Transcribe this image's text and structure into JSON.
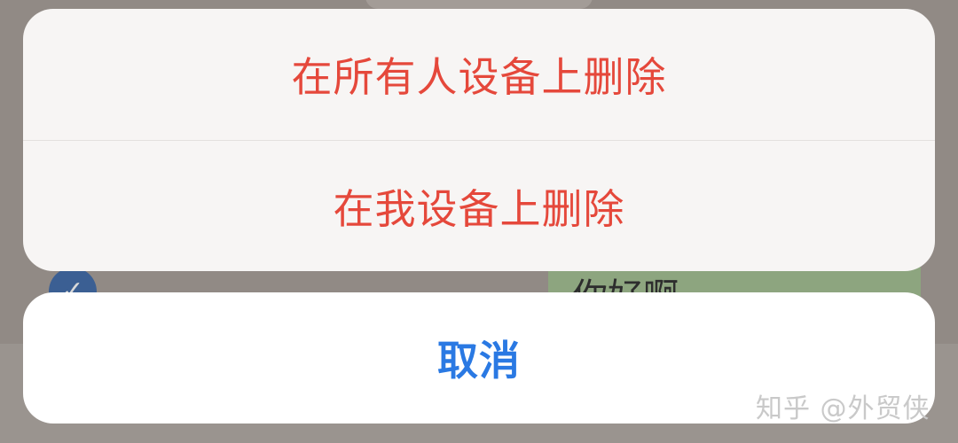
{
  "background": {
    "bubble_text": "你好啊",
    "check_symbol": "✓"
  },
  "action_sheet": {
    "delete_for_everyone_label": "在所有人设备上删除",
    "delete_for_me_label": "在我设备上删除",
    "cancel_label": "取消",
    "destructive_color": "#e5483b",
    "cancel_color": "#2a79e3"
  },
  "watermark": {
    "text": "知乎 @外贸侠"
  }
}
